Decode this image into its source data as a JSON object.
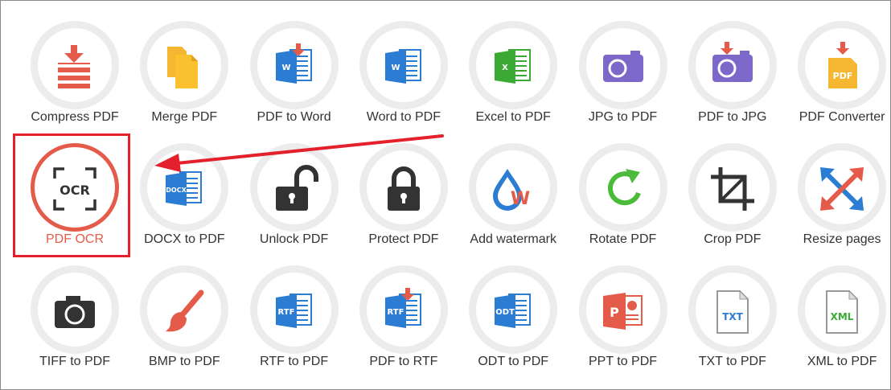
{
  "colors": {
    "accent": "#e55b4a",
    "annotation": "#e3202b",
    "ring": "#ececec",
    "label": "#333333"
  },
  "tools": [
    {
      "label": "Compress PDF",
      "icon": "compress-icon"
    },
    {
      "label": "Merge PDF",
      "icon": "merge-icon"
    },
    {
      "label": "PDF to Word",
      "icon": "pdf-to-word-icon"
    },
    {
      "label": "Word to PDF",
      "icon": "word-icon"
    },
    {
      "label": "Excel to PDF",
      "icon": "excel-icon"
    },
    {
      "label": "JPG to PDF",
      "icon": "camera-icon"
    },
    {
      "label": "PDF to JPG",
      "icon": "pdf-to-jpg-icon"
    },
    {
      "label": "PDF Converter",
      "icon": "pdf-converter-icon",
      "badge": "PDF"
    },
    {
      "label": "PDF OCR",
      "icon": "ocr-icon",
      "badge": "OCR",
      "active": true
    },
    {
      "label": "DOCX to PDF",
      "icon": "docx-icon",
      "badge": "DOCX"
    },
    {
      "label": "Unlock PDF",
      "icon": "unlock-icon"
    },
    {
      "label": "Protect PDF",
      "icon": "lock-icon"
    },
    {
      "label": "Add watermark",
      "icon": "watermark-icon",
      "badge": "W"
    },
    {
      "label": "Rotate PDF",
      "icon": "rotate-icon"
    },
    {
      "label": "Crop PDF",
      "icon": "crop-icon"
    },
    {
      "label": "Resize pages",
      "icon": "resize-icon"
    },
    {
      "label": "TIFF to PDF",
      "icon": "tiff-camera-icon"
    },
    {
      "label": "BMP to PDF",
      "icon": "brush-icon"
    },
    {
      "label": "RTF to PDF",
      "icon": "rtf-icon",
      "badge": "RTF"
    },
    {
      "label": "PDF to RTF",
      "icon": "pdf-to-rtf-icon",
      "badge": "RTF"
    },
    {
      "label": "ODT to PDF",
      "icon": "odt-icon",
      "badge": "ODT"
    },
    {
      "label": "PPT to PDF",
      "icon": "ppt-icon",
      "badge": "P"
    },
    {
      "label": "TXT to PDF",
      "icon": "txt-icon",
      "badge": "TXT"
    },
    {
      "label": "XML to PDF",
      "icon": "xml-icon",
      "badge": "XML"
    }
  ]
}
